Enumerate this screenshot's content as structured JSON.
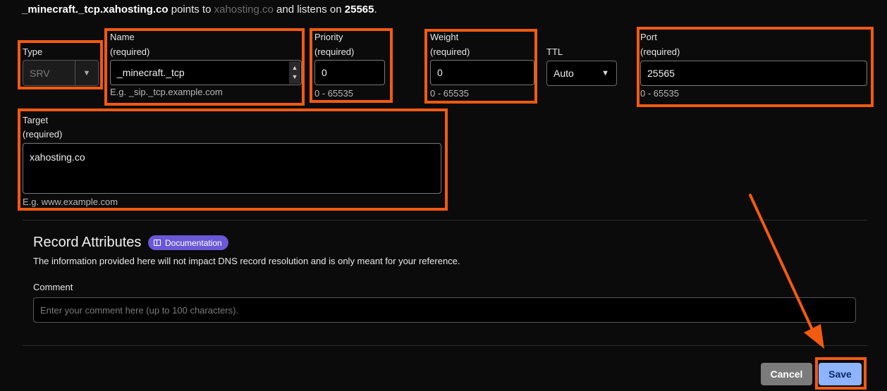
{
  "summary": {
    "record_name": "_minecraft._tcp.xahosting.co",
    "points_to_text": "points to",
    "target": "xahosting.co",
    "listens_text": "and listens on",
    "port": "25565",
    "end": "."
  },
  "fields": {
    "type": {
      "label": "Type",
      "value": "SRV"
    },
    "name": {
      "label": "Name",
      "required": "(required)",
      "value": "_minecraft._tcp",
      "hint": "E.g. _sip._tcp.example.com"
    },
    "priority": {
      "label": "Priority",
      "required": "(required)",
      "value": "0",
      "hint": "0 - 65535"
    },
    "weight": {
      "label": "Weight",
      "required": "(required)",
      "value": "0",
      "hint": "0 - 65535"
    },
    "ttl": {
      "label": "TTL",
      "value": "Auto"
    },
    "port": {
      "label": "Port",
      "required": "(required)",
      "value": "25565",
      "hint": "0 - 65535"
    },
    "target": {
      "label": "Target",
      "required": "(required)",
      "value": "xahosting.co",
      "hint": "E.g. www.example.com"
    }
  },
  "record_attributes": {
    "title": "Record Attributes",
    "doc_badge": "Documentation",
    "description": "The information provided here will not impact DNS record resolution and is only meant for your reference.",
    "comment_label": "Comment",
    "comment_placeholder": "Enter your comment here (up to 100 characters)."
  },
  "actions": {
    "cancel": "Cancel",
    "save": "Save"
  },
  "colors": {
    "highlight": "#f25a12",
    "save_button": "#8fb4ff",
    "doc_badge": "#6b58d6"
  },
  "icons": {
    "select_caret": "chevron-down-icon",
    "stepper": "stepper-arrows-icon",
    "documentation": "book-icon",
    "annotation_arrow": "arrow-icon"
  }
}
